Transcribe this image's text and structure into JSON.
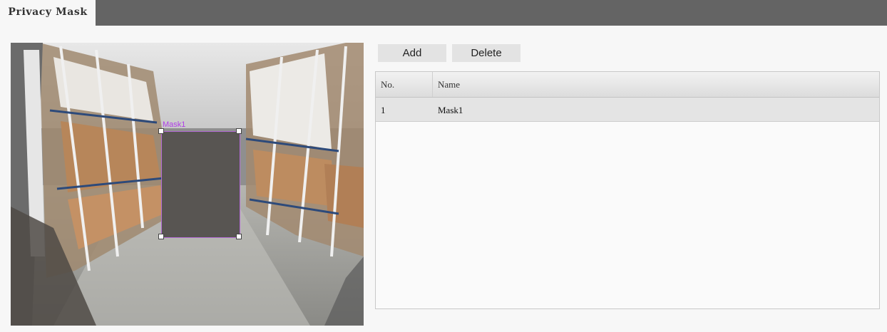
{
  "tabs": [
    {
      "label": "Privacy Mask",
      "active": true
    }
  ],
  "video": {
    "mask_overlay_label": "Mask1",
    "mask_color": "#585552",
    "mask_border_color": "#b36bd6"
  },
  "toolbar": {
    "add_label": "Add",
    "delete_label": "Delete"
  },
  "table": {
    "columns": [
      "No.",
      "Name"
    ],
    "rows": [
      {
        "no": "1",
        "name": "Mask1"
      }
    ]
  },
  "colors": {
    "tab_bar": "#646464",
    "background": "#f7f7f7",
    "button": "#e3e3e3",
    "selected_row": "#e4e4e4"
  }
}
